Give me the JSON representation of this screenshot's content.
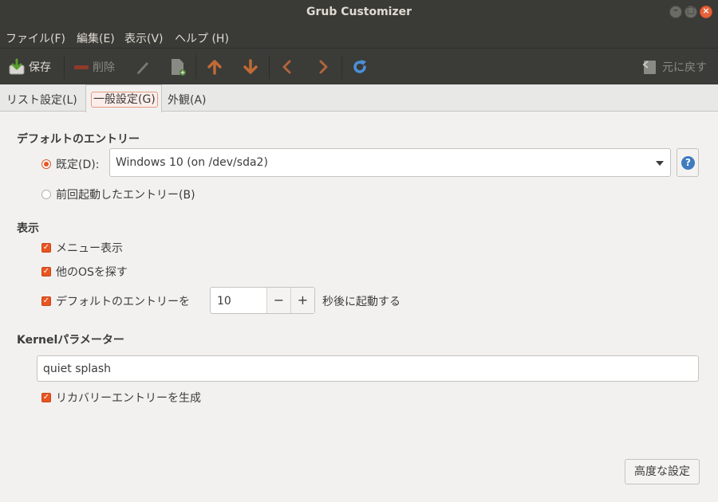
{
  "window": {
    "title": "Grub Customizer"
  },
  "menubar": {
    "items": [
      "ファイル(F)",
      "編集(E)",
      "表示(V)",
      "ヘルプ (H)"
    ]
  },
  "toolbar": {
    "save_label": "保存",
    "delete_label": "削除",
    "revert_label": "元に戻す",
    "icons": [
      "save-icon",
      "delete-icon",
      "edit-icon",
      "new-entry-icon",
      "arrow-up-icon",
      "arrow-down-icon",
      "arrow-left-icon",
      "arrow-right-icon",
      "reload-icon",
      "revert-icon"
    ]
  },
  "tabs": [
    {
      "label": "リスト設定(L)",
      "active": false
    },
    {
      "label": "一般設定(G)",
      "active": true
    },
    {
      "label": "外観(A)",
      "active": false
    }
  ],
  "default_entry": {
    "heading": "デフォルトのエントリー",
    "predefined_label": "既定(D):",
    "predefined_value": "Windows 10 (on /dev/sda2)",
    "previous_label": "前回起動したエントリー(B)",
    "help_glyph": "?"
  },
  "display": {
    "heading": "表示",
    "show_menu_label": "メニュー表示",
    "look_for_os_label": "他のOSを探す",
    "boot_default_label": "デフォルトのエントリーを",
    "timeout_value": "10",
    "timeout_suffix": "秒後に起動する",
    "minus": "−",
    "plus": "+"
  },
  "kernel": {
    "heading": "Kernelパラメーター",
    "value": "quiet splash",
    "recovery_label": "リカバリーエントリーを生成"
  },
  "advanced_button": "高度な設定",
  "colors": {
    "accent": "#e95420",
    "titlebar": "#3a3a37",
    "window_bg": "#f2f1f0",
    "help_blue": "#3f7bbf"
  }
}
